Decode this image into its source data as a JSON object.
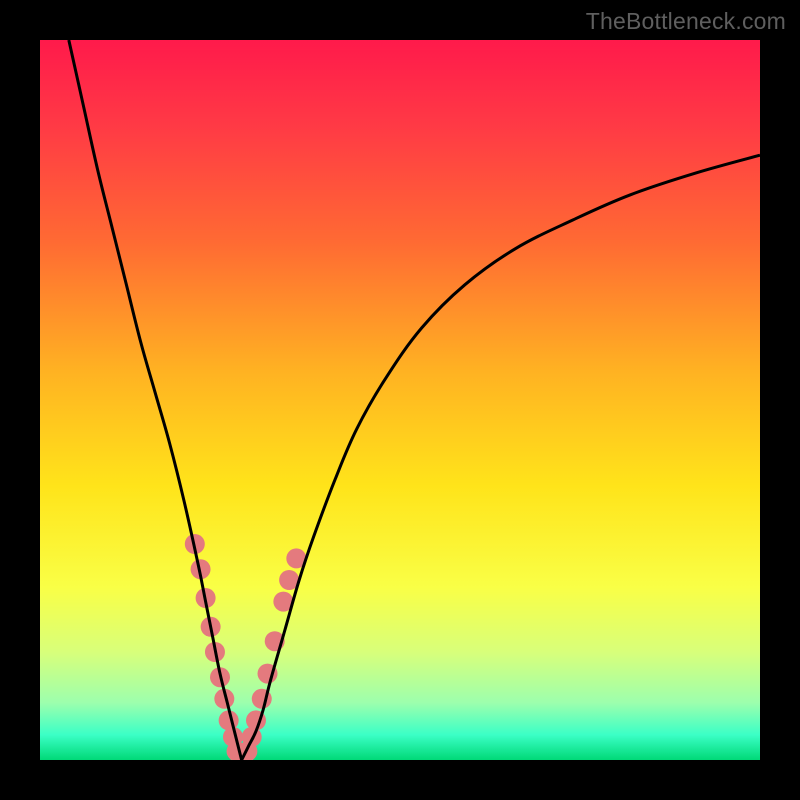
{
  "watermark": "TheBottleneck.com",
  "chart_data": {
    "type": "line",
    "title": "",
    "xlabel": "",
    "ylabel": "",
    "xlim": [
      0,
      100
    ],
    "ylim": [
      0,
      100
    ],
    "legend": false,
    "grid": false,
    "background_gradient": {
      "stops": [
        {
          "pos": 0.0,
          "color": "#ff1a4b"
        },
        {
          "pos": 0.12,
          "color": "#ff3a45"
        },
        {
          "pos": 0.28,
          "color": "#ff6a33"
        },
        {
          "pos": 0.46,
          "color": "#ffb222"
        },
        {
          "pos": 0.62,
          "color": "#ffe41a"
        },
        {
          "pos": 0.76,
          "color": "#f9ff46"
        },
        {
          "pos": 0.85,
          "color": "#d8ff7a"
        },
        {
          "pos": 0.92,
          "color": "#9dffad"
        },
        {
          "pos": 0.965,
          "color": "#3bffc6"
        },
        {
          "pos": 1.0,
          "color": "#00d977"
        }
      ]
    },
    "series": [
      {
        "name": "bottleneck-left",
        "color": "#000000",
        "x": [
          4,
          6,
          8,
          10,
          12,
          14,
          16,
          18,
          20,
          22,
          23,
          24,
          25,
          26,
          27,
          27.5,
          28
        ],
        "y": [
          100,
          91,
          82,
          74,
          66,
          58,
          51,
          44,
          36,
          27,
          22,
          17,
          12,
          8,
          4,
          2,
          0
        ]
      },
      {
        "name": "bottleneck-right",
        "color": "#000000",
        "x": [
          28,
          29,
          30,
          31,
          32,
          34,
          36,
          38,
          41,
          44,
          48,
          53,
          59,
          66,
          74,
          82,
          91,
          100
        ],
        "y": [
          0,
          2,
          4,
          7,
          11,
          18,
          25,
          31,
          39,
          46,
          53,
          60,
          66,
          71,
          75,
          78.5,
          81.5,
          84
        ]
      }
    ],
    "scatter_points": {
      "name": "highlight-band",
      "color": "#e47a7e",
      "points": [
        {
          "x": 21.5,
          "y": 30
        },
        {
          "x": 22.3,
          "y": 26.5
        },
        {
          "x": 23.0,
          "y": 22.5
        },
        {
          "x": 23.7,
          "y": 18.5
        },
        {
          "x": 24.3,
          "y": 15
        },
        {
          "x": 25.0,
          "y": 11.5
        },
        {
          "x": 25.6,
          "y": 8.5
        },
        {
          "x": 26.2,
          "y": 5.5
        },
        {
          "x": 26.8,
          "y": 3.2
        },
        {
          "x": 27.3,
          "y": 1.2
        },
        {
          "x": 27.8,
          "y": 0.5
        },
        {
          "x": 28.3,
          "y": 0.5
        },
        {
          "x": 28.8,
          "y": 1.2
        },
        {
          "x": 29.4,
          "y": 3.2
        },
        {
          "x": 30.0,
          "y": 5.5
        },
        {
          "x": 30.8,
          "y": 8.5
        },
        {
          "x": 31.6,
          "y": 12.0
        },
        {
          "x": 32.6,
          "y": 16.5
        },
        {
          "x": 33.8,
          "y": 22
        },
        {
          "x": 34.6,
          "y": 25
        },
        {
          "x": 35.6,
          "y": 28
        }
      ]
    }
  }
}
